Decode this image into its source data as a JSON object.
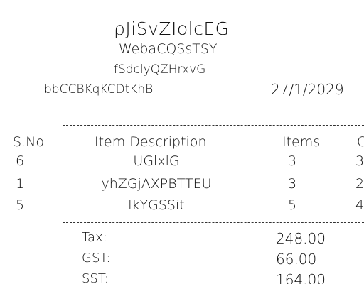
{
  "header": {
    "store_name": "ρJiSvZIolcEG",
    "store_line_1": "WebaCQSsTSY",
    "store_line_2": "fSdclyQZHrxvG",
    "cashier": "bbCCBKqKCDtKhB",
    "date": "27/1/2029"
  },
  "columns": {
    "sno": "S.No",
    "description": "Item Description",
    "items": "Items",
    "price": "C"
  },
  "rows": [
    {
      "sno": "6",
      "description": "UGlxlG",
      "items": "3",
      "price": "3"
    },
    {
      "sno": "1",
      "description": "yhZGjAXPBTTEU",
      "items": "3",
      "price": "2"
    },
    {
      "sno": "5",
      "description": "lkYGSSit",
      "items": "5",
      "price": "4"
    }
  ],
  "summary": [
    {
      "label": "Tax:",
      "value": "248.00"
    },
    {
      "label": "GST:",
      "value": "66.00"
    },
    {
      "label": "SST:",
      "value": "164.00"
    }
  ]
}
